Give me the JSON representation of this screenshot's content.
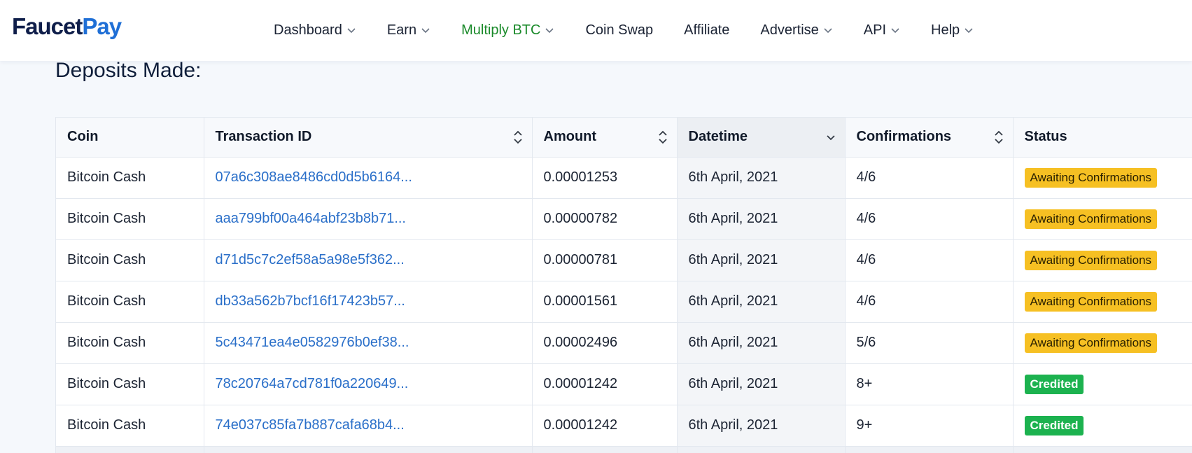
{
  "brand": {
    "part1": "Faucet",
    "part2": "Pay",
    "color_dark": "#0f1e4a",
    "color_blue": "#1f6fd6"
  },
  "nav": [
    {
      "label": "Dashboard",
      "dropdown": true,
      "active": false
    },
    {
      "label": "Earn",
      "dropdown": true,
      "active": false
    },
    {
      "label": "Multiply BTC",
      "dropdown": true,
      "active": true
    },
    {
      "label": "Coin Swap",
      "dropdown": false,
      "active": false
    },
    {
      "label": "Affiliate",
      "dropdown": false,
      "active": false
    },
    {
      "label": "Advertise",
      "dropdown": true,
      "active": false
    },
    {
      "label": "API",
      "dropdown": true,
      "active": false
    },
    {
      "label": "Help",
      "dropdown": true,
      "active": false
    }
  ],
  "page": {
    "title": "Deposits Made:"
  },
  "table": {
    "columns": [
      {
        "label": "Coin",
        "sort": "none"
      },
      {
        "label": "Transaction ID",
        "sort": "both"
      },
      {
        "label": "Amount",
        "sort": "both"
      },
      {
        "label": "Datetime",
        "sort": "desc"
      },
      {
        "label": "Confirmations",
        "sort": "both"
      },
      {
        "label": "Status",
        "sort": "none"
      }
    ],
    "rows": [
      {
        "coin": "Bitcoin Cash",
        "txid": "07a6c308ae8486cd0d5b6164...",
        "amount": "0.00001253",
        "datetime": "6th April, 2021",
        "confirmations": "4/6",
        "status": "Awaiting Confirmations",
        "status_type": "await"
      },
      {
        "coin": "Bitcoin Cash",
        "txid": "aaa799bf00a464abf23b8b71...",
        "amount": "0.00000782",
        "datetime": "6th April, 2021",
        "confirmations": "4/6",
        "status": "Awaiting Confirmations",
        "status_type": "await"
      },
      {
        "coin": "Bitcoin Cash",
        "txid": "d71d5c7c2ef58a5a98e5f362...",
        "amount": "0.00000781",
        "datetime": "6th April, 2021",
        "confirmations": "4/6",
        "status": "Awaiting Confirmations",
        "status_type": "await"
      },
      {
        "coin": "Bitcoin Cash",
        "txid": "db33a562b7bcf16f17423b57...",
        "amount": "0.00001561",
        "datetime": "6th April, 2021",
        "confirmations": "4/6",
        "status": "Awaiting Confirmations",
        "status_type": "await"
      },
      {
        "coin": "Bitcoin Cash",
        "txid": "5c43471ea4e0582976b0ef38...",
        "amount": "0.00002496",
        "datetime": "6th April, 2021",
        "confirmations": "5/6",
        "status": "Awaiting Confirmations",
        "status_type": "await"
      },
      {
        "coin": "Bitcoin Cash",
        "txid": "78c20764a7cd781f0a220649...",
        "amount": "0.00001242",
        "datetime": "6th April, 2021",
        "confirmations": "8+",
        "status": "Credited",
        "status_type": "credited"
      },
      {
        "coin": "Bitcoin Cash",
        "txid": "74e037c85fa7b887cafa68b4...",
        "amount": "0.00001242",
        "datetime": "6th April, 2021",
        "confirmations": "9+",
        "status": "Credited",
        "status_type": "credited"
      }
    ]
  },
  "colors": {
    "active_nav": "#1a8a2a",
    "link": "#2a6fc9",
    "await_badge": "#f6c023",
    "credited_badge": "#1cb24f"
  }
}
